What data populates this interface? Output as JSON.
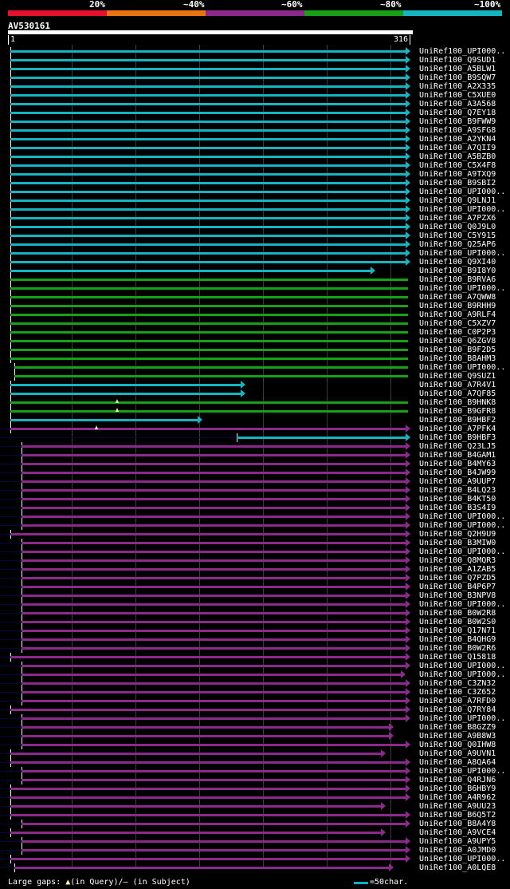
{
  "legend": {
    "labels": [
      "20%",
      "~40%",
      "~60%",
      "~80%",
      "~100%"
    ],
    "colors": [
      "#e8112d",
      "#e87511",
      "#8b2a8b",
      "#18a018",
      "#16b4c0"
    ]
  },
  "query": {
    "name": "AV530161",
    "start": "1",
    "end": "316"
  },
  "footer": {
    "large_gaps_label": "Large gaps: ",
    "query_gap_text": "(in Query)/",
    "subject_gap_text": "— (in Subject)",
    "scale_label": "=50char."
  },
  "hits": [
    {
      "label": "UniRef100_UPI000..",
      "color": "cyan"
    },
    {
      "label": "UniRef100_Q9SUD1",
      "color": "cyan"
    },
    {
      "label": "UniRef100_A5BLW1",
      "color": "cyan"
    },
    {
      "label": "UniRef100_B9SQW7",
      "color": "cyan"
    },
    {
      "label": "UniRef100_A2X335",
      "color": "cyan"
    },
    {
      "label": "UniRef100_C5XUE0",
      "color": "cyan"
    },
    {
      "label": "UniRef100_A3A568",
      "color": "cyan"
    },
    {
      "label": "UniRef100_Q7EY18",
      "color": "cyan"
    },
    {
      "label": "UniRef100_B9FWW9",
      "color": "cyan"
    },
    {
      "label": "UniRef100_A9SFG8",
      "color": "cyan"
    },
    {
      "label": "UniRef100_A2YKN4",
      "color": "cyan"
    },
    {
      "label": "UniRef100_A7QII9",
      "color": "cyan"
    },
    {
      "label": "UniRef100_A5BZB0",
      "color": "cyan"
    },
    {
      "label": "UniRef100_C5X4F8",
      "color": "cyan"
    },
    {
      "label": "UniRef100_A9TXQ9",
      "color": "cyan"
    },
    {
      "label": "UniRef100_B9SBI2",
      "color": "cyan"
    },
    {
      "label": "UniRef100_UPI000..",
      "color": "cyan"
    },
    {
      "label": "UniRef100_Q9LNJ1",
      "color": "cyan"
    },
    {
      "label": "UniRef100_UPI000..",
      "color": "cyan"
    },
    {
      "label": "UniRef100_A7PZX6",
      "color": "cyan"
    },
    {
      "label": "UniRef100_Q0J9L0",
      "color": "cyan"
    },
    {
      "label": "UniRef100_C5Y915",
      "color": "cyan"
    },
    {
      "label": "UniRef100_Q25AP6",
      "color": "cyan"
    },
    {
      "label": "UniRef100_UPI000..",
      "color": "cyan"
    },
    {
      "label": "UniRef100_Q9XI40",
      "color": "cyan"
    },
    {
      "label": "UniRef100_B9I8Y0",
      "color": "cyan"
    },
    {
      "label": "UniRef100_B9RVA6",
      "color": "green"
    },
    {
      "label": "UniRef100_UPI000..",
      "color": "green"
    },
    {
      "label": "UniRef100_A7QWW8",
      "color": "green"
    },
    {
      "label": "UniRef100_B9RHH9",
      "color": "green"
    },
    {
      "label": "UniRef100_A9RLF4",
      "color": "green"
    },
    {
      "label": "UniRef100_C5XZV7",
      "color": "green"
    },
    {
      "label": "UniRef100_C0P2P3",
      "color": "green"
    },
    {
      "label": "UniRef100_Q6ZGV8",
      "color": "green"
    },
    {
      "label": "UniRef100_B9F2D5",
      "color": "green"
    },
    {
      "label": "UniRef100_B8AHM3",
      "color": "green"
    },
    {
      "label": "UniRef100_UPI000..",
      "color": "green"
    },
    {
      "label": "UniRef100_Q9SUZ1",
      "color": "green"
    },
    {
      "label": "UniRef100_A7R4V1",
      "color": "cyan"
    },
    {
      "label": "UniRef100_A7QF85",
      "color": "cyan"
    },
    {
      "label": "UniRef100_B9HNK8",
      "color": "green"
    },
    {
      "label": "UniRef100_B9GFR8",
      "color": "green"
    },
    {
      "label": "UniRef100_B9HBF2",
      "color": "cyan"
    },
    {
      "label": "UniRef100_A7PFK4",
      "color": "purple"
    },
    {
      "label": "UniRef100_B9HBF3",
      "color": "cyan"
    },
    {
      "label": "UniRef100_Q23LJ5",
      "color": "purple"
    },
    {
      "label": "UniRef100_B4GAM1",
      "color": "purple"
    },
    {
      "label": "UniRef100_B4MY63",
      "color": "purple"
    },
    {
      "label": "UniRef100_B4JW99",
      "color": "purple"
    },
    {
      "label": "UniRef100_A9UUP7",
      "color": "purple"
    },
    {
      "label": "UniRef100_B4LQ23",
      "color": "purple"
    },
    {
      "label": "UniRef100_B4KT50",
      "color": "purple"
    },
    {
      "label": "UniRef100_B3S4I9",
      "color": "purple"
    },
    {
      "label": "UniRef100_UPI000..",
      "color": "purple"
    },
    {
      "label": "UniRef100_UPI000..",
      "color": "purple"
    },
    {
      "label": "UniRef100_Q2H9U9",
      "color": "purple"
    },
    {
      "label": "UniRef100_B3MIW0",
      "color": "purple"
    },
    {
      "label": "UniRef100_UPI000..",
      "color": "purple"
    },
    {
      "label": "UniRef100_Q8MQR3",
      "color": "purple"
    },
    {
      "label": "UniRef100_A1ZAB5",
      "color": "purple"
    },
    {
      "label": "UniRef100_Q7PZD5",
      "color": "purple"
    },
    {
      "label": "UniRef100_B4P6P7",
      "color": "purple"
    },
    {
      "label": "UniRef100_B3NPV8",
      "color": "purple"
    },
    {
      "label": "UniRef100_UPI000..",
      "color": "purple"
    },
    {
      "label": "UniRef100_B0W2R8",
      "color": "purple"
    },
    {
      "label": "UniRef100_B0W2S0",
      "color": "purple"
    },
    {
      "label": "UniRef100_Q17N71",
      "color": "purple"
    },
    {
      "label": "UniRef100_B4QHG9",
      "color": "purple"
    },
    {
      "label": "UniRef100_B0W2R6",
      "color": "purple"
    },
    {
      "label": "UniRef100_Q15818",
      "color": "purple"
    },
    {
      "label": "UniRef100_UPI000..",
      "color": "purple"
    },
    {
      "label": "UniRef100_UPI000..",
      "color": "purple"
    },
    {
      "label": "UniRef100_C3ZN32",
      "color": "purple"
    },
    {
      "label": "UniRef100_C3Z652",
      "color": "purple"
    },
    {
      "label": "UniRef100_A7RFD0",
      "color": "purple"
    },
    {
      "label": "UniRef100_Q7RY84",
      "color": "purple"
    },
    {
      "label": "UniRef100_UPI000..",
      "color": "purple"
    },
    {
      "label": "UniRef100_B8GZZ9",
      "color": "purple"
    },
    {
      "label": "UniRef100_A9B8W3",
      "color": "purple"
    },
    {
      "label": "UniRef100_Q0IHW8",
      "color": "purple"
    },
    {
      "label": "UniRef100_A9UVN1",
      "color": "purple"
    },
    {
      "label": "UniRef100_A8QA64",
      "color": "purple"
    },
    {
      "label": "UniRef100_UPI000..",
      "color": "purple"
    },
    {
      "label": "UniRef100_Q4RJN6",
      "color": "purple"
    },
    {
      "label": "UniRef100_B6HBY9",
      "color": "purple"
    },
    {
      "label": "UniRef100_A4R962",
      "color": "purple"
    },
    {
      "label": "UniRef100_A9UU23",
      "color": "purple"
    },
    {
      "label": "UniRef100_B6Q5T2",
      "color": "purple"
    },
    {
      "label": "UniRef100_B8A4Y8",
      "color": "purple"
    },
    {
      "label": "UniRef100_A9VCE4",
      "color": "purple"
    },
    {
      "label": "UniRef100_A9UPY5",
      "color": "purple"
    },
    {
      "label": "UniRef100_A0JMD0",
      "color": "purple"
    },
    {
      "label": "UniRef100_UPI000..",
      "color": "purple"
    },
    {
      "label": "UniRef100_A0LQE8",
      "color": "purple"
    }
  ]
}
